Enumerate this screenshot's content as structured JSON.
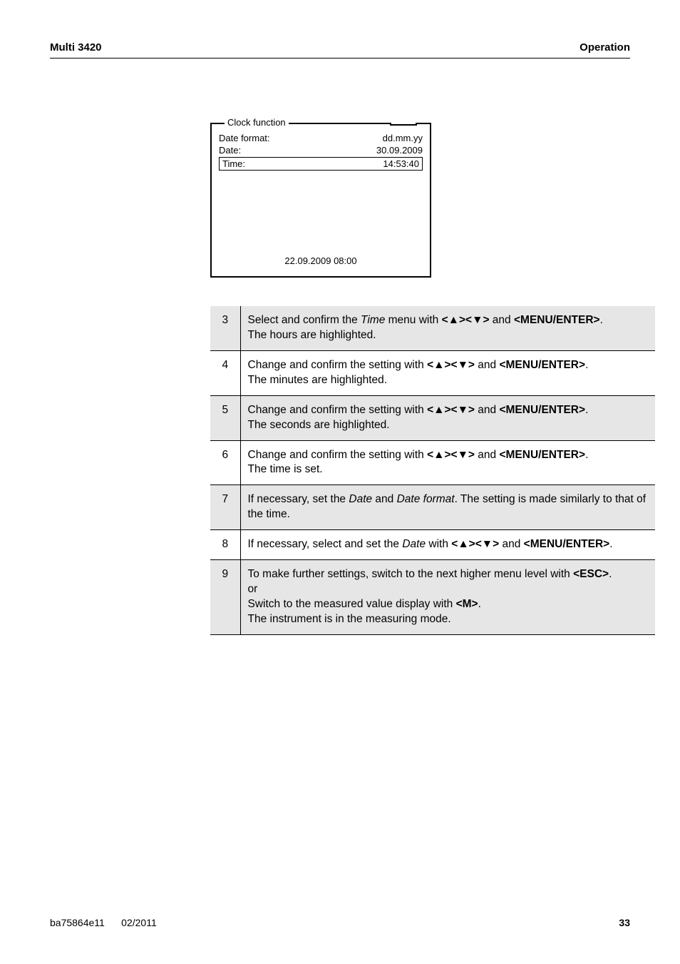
{
  "header": {
    "left": "Multi 3420",
    "right": "Operation"
  },
  "clock": {
    "title": "Clock function",
    "rows": {
      "date_format_label": "Date format:",
      "date_format_value": "dd.mm.yy",
      "date_label": "Date:",
      "date_value": "30.09.2009",
      "time_label": "Time:",
      "time_value": "14:53:40"
    },
    "footer": "22.09.2009 08:00"
  },
  "steps": [
    {
      "n": "3",
      "grey": true,
      "pre": "Select and confirm the ",
      "em1": "Time",
      "mid1": " menu with ",
      "keys": "<▲><▼>",
      "mid2": " and ",
      "key2": "<MENU/ENTER>",
      "post": ".",
      "line2": "The hours are highlighted."
    },
    {
      "n": "4",
      "grey": false,
      "pre": "Change and confirm the setting with ",
      "keys": "<▲><▼>",
      "mid2": " and ",
      "key2": "<MENU/ENTER>",
      "post": ".",
      "line2": "The minutes are highlighted."
    },
    {
      "n": "5",
      "grey": true,
      "pre": "Change and confirm the setting with ",
      "keys": "<▲><▼>",
      "mid2": " and ",
      "key2": "<MENU/ENTER>",
      "post": ".",
      "line2": "The seconds are highlighted."
    },
    {
      "n": "6",
      "grey": false,
      "pre": "Change and confirm the setting with ",
      "keys": "<▲><▼>",
      "mid2": " and ",
      "key2": "<MENU/ENTER>",
      "post": ".",
      "line2": "The time is set."
    },
    {
      "n": "7",
      "grey": true,
      "full7_a": "If necessary, set the ",
      "full7_em1": "Date",
      "full7_b": " and ",
      "full7_em2": "Date format",
      "full7_c": ". The setting is made similarly to that of the time."
    },
    {
      "n": "8",
      "grey": false,
      "full8_a": "If necessary, select and set the ",
      "full8_em": "Date",
      "full8_b": " with ",
      "full8_keys": "<▲><▼>",
      "full8_c": " and ",
      "full8_key2": "<MENU/ENTER>",
      "full8_d": "."
    },
    {
      "n": "9",
      "grey": true,
      "s9_a": "To make further settings, switch to the next higher menu level with ",
      "s9_esc": "<ESC>",
      "s9_b": ".",
      "s9_or": "or",
      "s9_c": "Switch to the measured value display with ",
      "s9_m": "<M>",
      "s9_d": ".",
      "s9_e": "The instrument is in the measuring mode."
    }
  ],
  "footer": {
    "left1": "ba75864e11",
    "left2": "02/2011",
    "page": "33"
  }
}
